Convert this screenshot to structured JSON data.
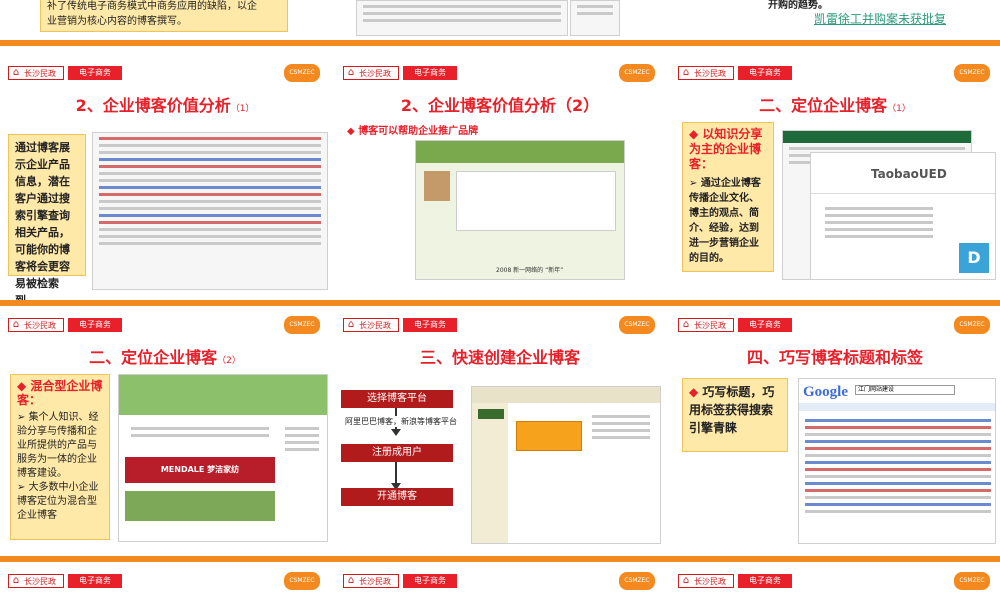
{
  "common": {
    "logo_text": "长沙民政",
    "tag": "电子商务",
    "badge": "CSMZEC"
  },
  "top": {
    "left_text_1": "补了传统电子商务模式中商务应用的缺陷，以企",
    "left_text_2": "业营销为核心内容的博客撰写。",
    "right_partial": "开购的趋势。",
    "right_link": "凯雷徐工并购案未获批复"
  },
  "slides": [
    {
      "title": "2、企业博客价值分析",
      "title_small": "（1）",
      "box_text": "通过博客展示企业产品信息，潜在客户通过搜索引擎查询相关产品，可能你的博客将会更容易被检索到。"
    },
    {
      "title": "2、企业博客价值分析（2）",
      "bullet": "博客可以帮助企业推广品牌",
      "caption": "2008 新一网络的 “新年”"
    },
    {
      "title": "二、定位企业博客",
      "title_small": "（1）",
      "box_heading": "以知识分享为主的企业博客：",
      "box_text": "通过企业博客传播企业文化、博主的观点、简介、经验，达到进一步营销企业的目的。",
      "brand": "TaobaoUED"
    },
    {
      "title": "二、定位企业博客",
      "title_small": "（2）",
      "box_heading": "混合型企业博客：",
      "items": [
        "集个人知识、经验分享与传播和企业所提供的产品与服务为一体的企业博客建设。",
        "大多数中小企业博客定位为混合型企业博客"
      ],
      "banner": "MENDALE 梦洁家纺"
    },
    {
      "title": "三、快速创建企业博客",
      "steps": [
        "选择博客平台",
        "注册成用户",
        "开通博客"
      ],
      "step_note": "阿里巴巴博客，新浪等博客平台"
    },
    {
      "title": "四、巧写博客标题和标签",
      "box_text": "巧写标题，巧用标签获得搜索引擎青睐",
      "google": "Google",
      "search_query": "江门网站建设"
    }
  ],
  "colors": {
    "accent_orange": "#f48a1f",
    "title_red": "#e8202a",
    "box_yellow": "#ffe9a8"
  }
}
